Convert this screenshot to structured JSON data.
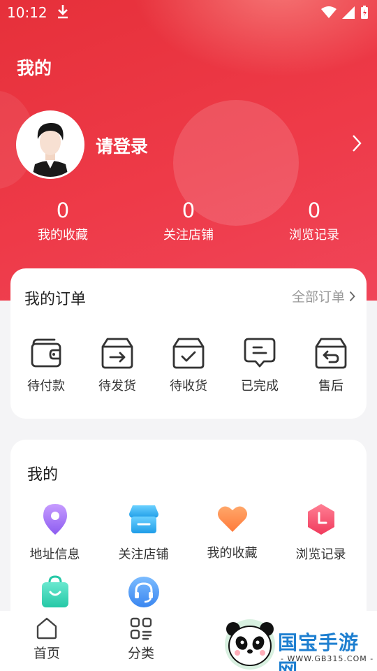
{
  "status_bar": {
    "time": "10:12"
  },
  "header": {
    "title": "我的"
  },
  "profile": {
    "login_text": "请登录"
  },
  "stats": [
    {
      "value": "0",
      "label": "我的收藏"
    },
    {
      "value": "0",
      "label": "关注店铺"
    },
    {
      "value": "0",
      "label": "浏览记录"
    }
  ],
  "orders": {
    "title": "我的订单",
    "all_label": "全部订单",
    "items": [
      {
        "label": "待付款",
        "icon": "wallet-icon"
      },
      {
        "label": "待发货",
        "icon": "box-arrow-icon"
      },
      {
        "label": "待收货",
        "icon": "box-check-icon"
      },
      {
        "label": "已完成",
        "icon": "message-done-icon"
      },
      {
        "label": "售后",
        "icon": "box-return-icon"
      }
    ]
  },
  "mine": {
    "title": "我的",
    "items": [
      {
        "label": "地址信息",
        "icon": "location-pin-icon",
        "color": "#a777f0"
      },
      {
        "label": "关注店铺",
        "icon": "store-icon",
        "color": "#37b6f2"
      },
      {
        "label": "我的收藏",
        "icon": "heart-icon",
        "color": "#ff8a4a"
      },
      {
        "label": "浏览记录",
        "icon": "clock-icon",
        "color": "#f4506c"
      },
      {
        "label": "",
        "icon": "shopping-bag-icon",
        "color": "#3cd6b6"
      },
      {
        "label": "",
        "icon": "customer-service-icon",
        "color": "#4f9cf6"
      }
    ]
  },
  "bottom_nav": [
    {
      "label": "首页",
      "icon": "home-icon"
    },
    {
      "label": "分类",
      "icon": "category-icon"
    }
  ],
  "watermark": {
    "brand": "国宝手游网",
    "site": "- WWW.GB315.COM -"
  },
  "colors": {
    "accent": "#e9323f",
    "card_bg": "#ffffff",
    "page_bg": "#f4f4f6"
  }
}
